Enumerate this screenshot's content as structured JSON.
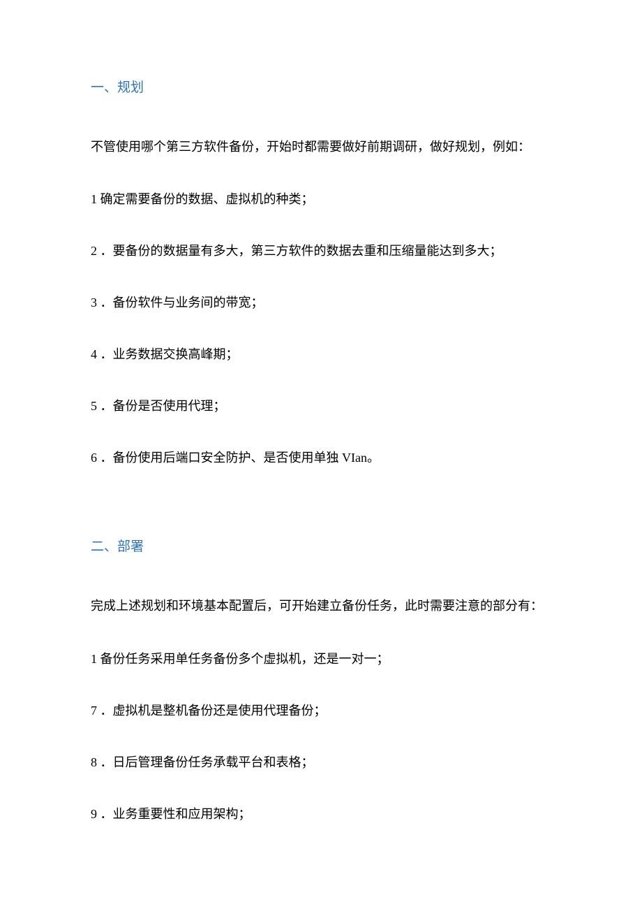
{
  "section1": {
    "heading": "一、规划",
    "intro": "不管使用哪个第三方软件备份，开始时都需要做好前期调研，做好规划，例如：",
    "items": [
      "1 确定需要备份的数据、虚拟机的种类；",
      "2 ．要备份的数据量有多大，第三方软件的数据去重和压缩量能达到多大；",
      "3 ．备份软件与业务间的带宽；",
      "4 ．业务数据交换高峰期；",
      "5 ．备份是否使用代理；",
      "6 ．备份使用后端口安全防护、是否使用单独 VIan。"
    ]
  },
  "section2": {
    "heading": "二、部署",
    "intro": "完成上述规划和环境基本配置后，可开始建立备份任务，此时需要注意的部分有：",
    "items": [
      "1 备份任务采用单任务备份多个虚拟机，还是一对一；",
      "7 ．虚拟机是整机备份还是使用代理备份；",
      "8 ．日后管理备份任务承载平台和表格；",
      "9 ．业务重要性和应用架构；"
    ]
  }
}
